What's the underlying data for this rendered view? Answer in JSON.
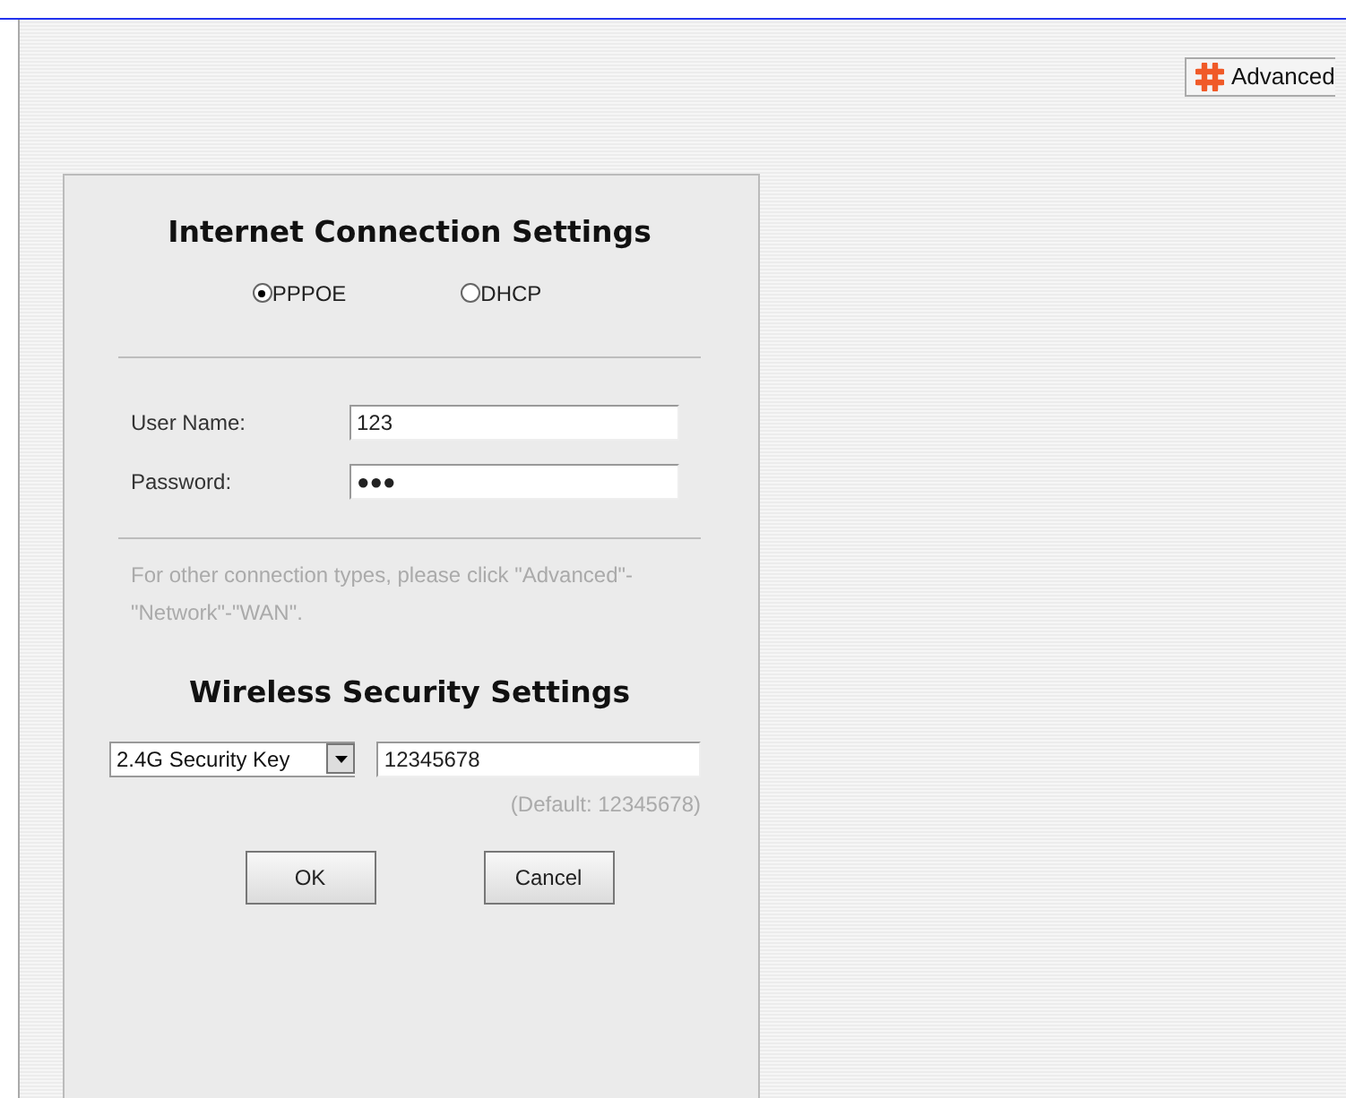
{
  "toolbar": {
    "advanced_button": "Advanced"
  },
  "internet": {
    "title": "Internet Connection Settings",
    "modes": [
      {
        "label": "PPPOE",
        "selected": true
      },
      {
        "label": "DHCP",
        "selected": false
      }
    ],
    "fields": [
      {
        "label": "User Name:",
        "value": "123"
      },
      {
        "label": "Password:",
        "value": "●●●"
      }
    ],
    "note": "For other connection types, please click \"Advanced\"-\"Network\"-\"WAN\"."
  },
  "wireless": {
    "title": "Wireless Security Settings",
    "band_select": "2.4G Security Key",
    "key_value": "12345678",
    "hint": "(Default: 12345678)"
  },
  "buttons": [
    "OK",
    "Cancel"
  ]
}
